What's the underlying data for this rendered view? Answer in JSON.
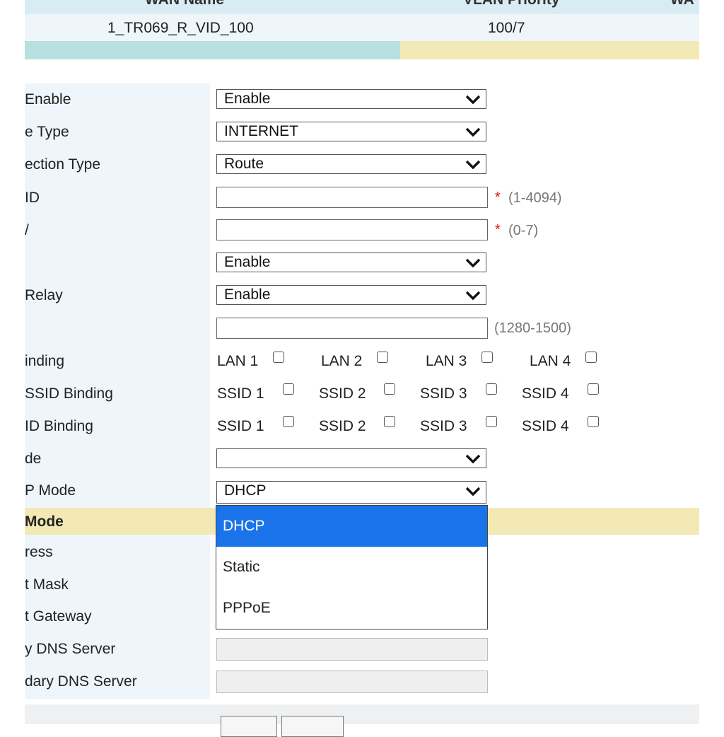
{
  "wan_table": {
    "headers": [
      "WAN Name",
      "VLAN Priority",
      "WA"
    ],
    "row": {
      "name": "1_TR069_R_VID_100",
      "vlan_priority": "100/7"
    }
  },
  "form": {
    "labels": {
      "enable": "Enable",
      "service_type": "e Type",
      "connection_type": "ection Type",
      "vlan_id": "ID",
      "priority": "/",
      "relay": "Relay",
      "lan_binding": "inding",
      "ssid_binding_1": "SSID Binding",
      "ssid_binding_2": "ID Binding",
      "mode": "de",
      "ip_mode": "P Mode",
      "section_mode": "Mode",
      "address": "ress",
      "mask": "t Mask",
      "gateway": "t Gateway",
      "primary_dns": "y DNS Server",
      "secondary_dns": "dary DNS Server"
    },
    "selects": {
      "enable": "Enable",
      "service_type": "INTERNET",
      "connection_type": "Route",
      "nat": "Enable",
      "relay": "Enable",
      "mode": "",
      "ip_mode": "DHCP"
    },
    "hints": {
      "vlan_id": "(1-4094)",
      "priority": "(0-7)",
      "mtu": "(1280-1500)",
      "required_mark": "*"
    },
    "lan_binding": [
      "LAN 1",
      "LAN 2",
      "LAN 3",
      "LAN 4"
    ],
    "ssid_binding_1": [
      "SSID 1",
      "SSID 2",
      "SSID 3",
      "SSID 4"
    ],
    "ssid_binding_2": [
      "SSID 1",
      "SSID 2",
      "SSID 3",
      "SSID 4"
    ]
  },
  "dropdown": {
    "options": [
      "DHCP",
      "Static",
      "PPPoE"
    ],
    "selected": "DHCP"
  },
  "colors": {
    "highlight": "#1a73e8",
    "section_band": "#f3e9b4",
    "teal_bar": "#b8e0e0"
  }
}
